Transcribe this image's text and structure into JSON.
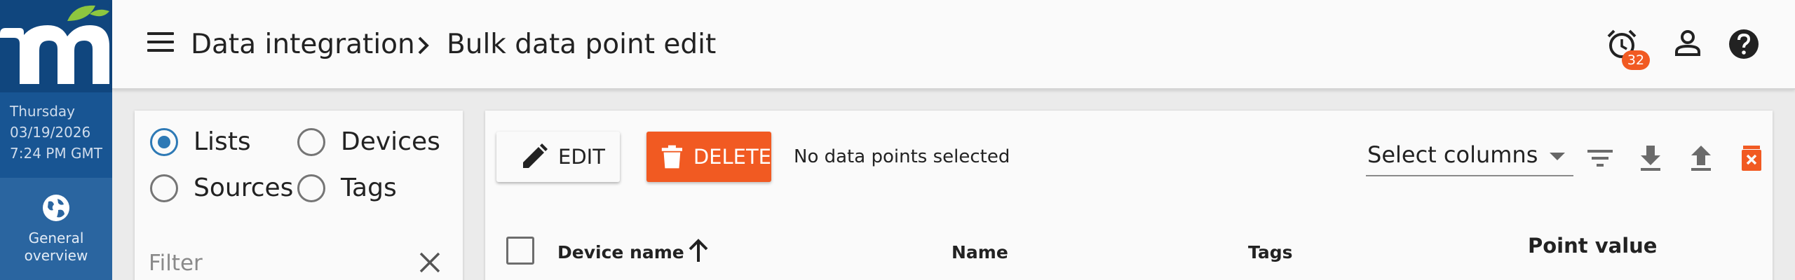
{
  "rail": {
    "day": "Thursday",
    "date": "03/19/2026",
    "time": "7:24 PM GMT",
    "nav_item": {
      "line1": "General",
      "line2": "overview",
      "icon": "globe-icon"
    },
    "colors": {
      "logo_bg": "#10467e",
      "date_bg": "#185593",
      "nav_bg": "#2a65a0",
      "leaf": "#8dc63f"
    }
  },
  "header": {
    "breadcrumb": [
      "Data integration",
      "Bulk data point edit"
    ],
    "menu_icon": "menu-icon",
    "alarm_count": "32",
    "icons": [
      "alarm-clock-icon",
      "person-icon",
      "help-icon"
    ]
  },
  "filter_panel": {
    "options": [
      {
        "label": "Lists",
        "checked": true
      },
      {
        "label": "Devices",
        "checked": false
      },
      {
        "label": "Sources",
        "checked": false
      },
      {
        "label": "Tags",
        "checked": false
      }
    ],
    "filter_placeholder": "Filter",
    "filter_value": ""
  },
  "toolbar": {
    "edit_label": "EDIT",
    "delete_label": "DELETE",
    "status": "No data points selected",
    "select_columns": "Select columns",
    "tools": [
      "filter-list-icon",
      "download-icon",
      "upload-icon",
      "delete-filter-icon"
    ]
  },
  "table": {
    "columns": [
      "Device name",
      "Name",
      "Tags",
      "Point value"
    ],
    "sorted_column": "Device name",
    "sort_direction": "ascending"
  },
  "colors": {
    "accent": "#2d79b5",
    "danger": "#f15a22"
  }
}
